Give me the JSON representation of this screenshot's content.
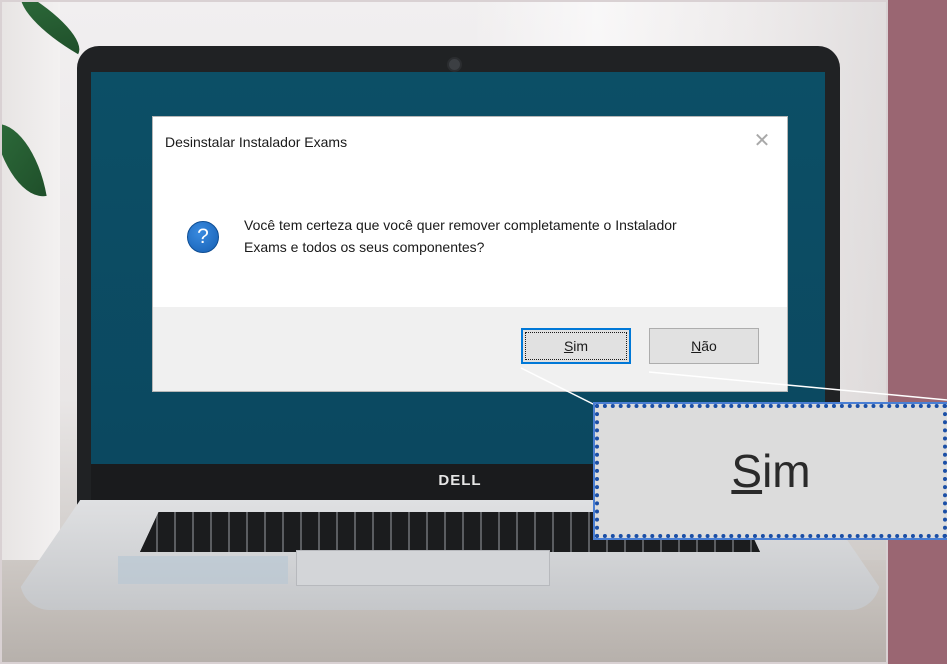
{
  "brand": {
    "laptop_logo": "DELL"
  },
  "dialog": {
    "title": "Desinstalar Instalador Exams",
    "close_icon": "close-icon",
    "question_icon": "question-icon",
    "question_glyph": "?",
    "message_line1": "Você tem certeza que você quer remover completamente o Instalador",
    "message_line2": "Exams e todos os seus componentes?",
    "buttons": {
      "yes_underlined": "S",
      "yes_rest": "im",
      "no_underlined": "N",
      "no_rest": "ão"
    }
  },
  "zoom": {
    "label_underlined": "S",
    "label_rest": "im"
  },
  "colors": {
    "page_background": "#9a6672",
    "screen": "#0c4f66",
    "focus_border": "#0078d7",
    "zoom_border": "#1b4fa6"
  }
}
